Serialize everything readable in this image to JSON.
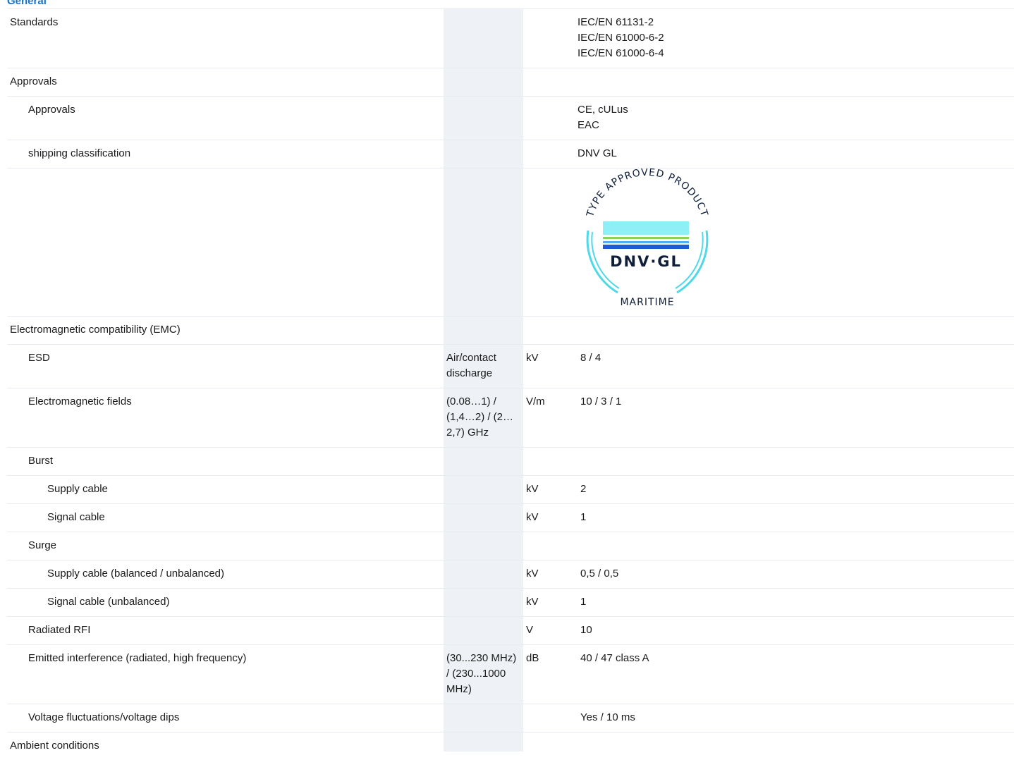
{
  "section_title": "General",
  "rows": {
    "standards": {
      "label": "Standards",
      "values": [
        "IEC/EN 61131-2",
        "IEC/EN 61000-6-2",
        "IEC/EN 61000-6-4"
      ]
    },
    "approvals_group": {
      "label": "Approvals"
    },
    "approvals": {
      "label": "Approvals",
      "values": [
        "CE, cULus",
        "EAC"
      ]
    },
    "shipping": {
      "label": "shipping classification",
      "value": "DNV GL"
    },
    "dnv_logo": {
      "arc_text": "TYPE APPROVED PRODUCT",
      "brand": "DNV·GL",
      "caption": "MARITIME",
      "colors": {
        "arc": "#4fd8e6",
        "band_top": "#8ef0f6",
        "band_green": "#8cd25a",
        "band_blue": "#1f5bd6",
        "brand": "#0f1f3a"
      }
    },
    "emc": {
      "label": "Electromagnetic compatibility (EMC)"
    },
    "esd": {
      "label": "ESD",
      "condition": "Air/contact discharge",
      "unit": "kV",
      "value": "8 / 4"
    },
    "em_fields": {
      "label": "Electromagnetic fields",
      "condition": "(0.08…1) / (1,4…2) / (2…2,7) GHz",
      "unit": "V/m",
      "value": "10 / 3 / 1"
    },
    "burst": {
      "label": "Burst"
    },
    "burst_supply": {
      "label": "Supply cable",
      "unit": "kV",
      "value": "2"
    },
    "burst_signal": {
      "label": "Signal cable",
      "unit": "kV",
      "value": "1"
    },
    "surge": {
      "label": "Surge"
    },
    "surge_supply": {
      "label": "Supply cable (balanced / unbalanced)",
      "unit": "kV",
      "value": "0,5 / 0,5"
    },
    "surge_signal": {
      "label": "Signal cable (unbalanced)",
      "unit": "kV",
      "value": "1"
    },
    "radiated_rfi": {
      "label": "Radiated RFI",
      "unit": "V",
      "value": "10"
    },
    "emitted": {
      "label": "Emitted interference (radiated, high frequency)",
      "condition": "(30...230 MHz) / (230...1000 MHz)",
      "unit": "dB",
      "value": "40 / 47 class A"
    },
    "voltage_fluct": {
      "label": "Voltage fluctuations/voltage dips",
      "value": "Yes / 10 ms"
    },
    "ambient": {
      "label": "Ambient conditions"
    }
  }
}
